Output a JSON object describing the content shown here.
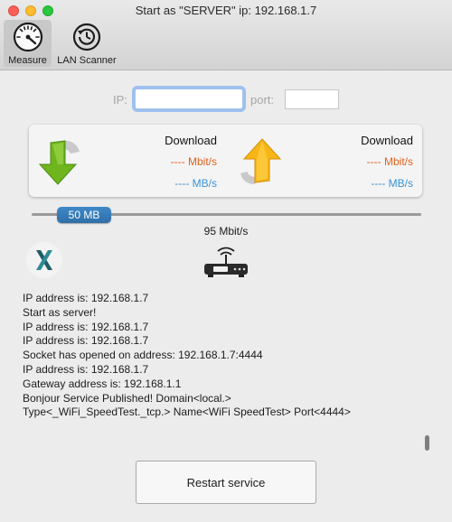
{
  "window": {
    "title": "Start as \"SERVER\" ip: 192.168.1.7"
  },
  "toolbar": {
    "items": [
      {
        "label": "Measure",
        "icon": "speedometer-icon",
        "selected": true
      },
      {
        "label": "LAN Scanner",
        "icon": "refresh-clock-icon",
        "selected": false
      }
    ]
  },
  "connection": {
    "ip_label": "IP:",
    "ip_value": "",
    "port_label": "port:",
    "port_value": ""
  },
  "speed": {
    "download_left": {
      "title": "Download",
      "mbit": "---- Mbit/s",
      "mb": "---- MB/s",
      "icon": "green-down-arrow-icon"
    },
    "download_right": {
      "title": "Download",
      "mbit": "---- Mbit/s",
      "mb": "---- MB/s",
      "icon": "orange-up-arrow-icon"
    }
  },
  "slider": {
    "label": "50 MB",
    "bandwidth": "95 Mbit/s"
  },
  "log": [
    "IP address is: 192.168.1.7",
    "Start as server!",
    "IP address is: 192.168.1.7",
    "IP address is: 192.168.1.7",
    "Socket has opened on address: 192.168.1.7:4444",
    "IP address is: 192.168.1.7",
    "Gateway address is: 192.168.1.1",
    "Bonjour Service Published! Domain<local.>",
    "Type<_WiFi_SpeedTest._tcp.> Name<WiFi SpeedTest> Port<4444>"
  ],
  "actions": {
    "restart_label": "Restart service"
  },
  "colors": {
    "mbit_text": "#e0611d",
    "mb_text": "#3b93d6",
    "slider_knob": "#3f88c9",
    "input_focus": "#9dc0ef"
  }
}
